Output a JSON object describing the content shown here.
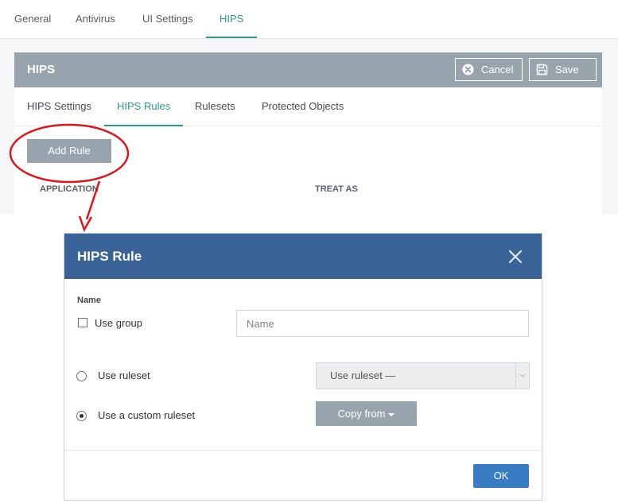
{
  "top_tabs": [
    "General",
    "Antivirus",
    "UI Settings",
    "HIPS"
  ],
  "top_tabs_active": "HIPS",
  "hips_panel": {
    "title": "HIPS",
    "cancel_label": "Cancel",
    "save_label": "Save",
    "sub_tabs": [
      "HIPS Settings",
      "HIPS Rules",
      "Rulesets",
      "Protected Objects"
    ],
    "sub_tabs_active": "HIPS Rules",
    "add_rule_label": "Add Rule",
    "columns": [
      "APPLICATION",
      "TREAT AS"
    ]
  },
  "modal": {
    "title": "HIPS Rule",
    "name_label": "Name",
    "use_group_label": "Use group",
    "use_group_checked": false,
    "name_placeholder": "Name",
    "use_ruleset_label": "Use ruleset",
    "use_ruleset_selected": false,
    "ruleset_select_value": "Use ruleset —",
    "custom_ruleset_label": "Use a custom ruleset",
    "custom_ruleset_selected": true,
    "copy_from_label": "Copy from",
    "ok_label": "OK"
  },
  "colors": {
    "accent_teal": "#2d9b8a",
    "header_gray": "#97a4ae",
    "modal_header_blue": "#3a6397",
    "ok_blue": "#3a7cc2",
    "annotation_red": "#e0141b"
  },
  "icons": [
    "cancel-icon",
    "save-icon",
    "close-icon",
    "chevron-down-icon",
    "caret-down-icon"
  ]
}
